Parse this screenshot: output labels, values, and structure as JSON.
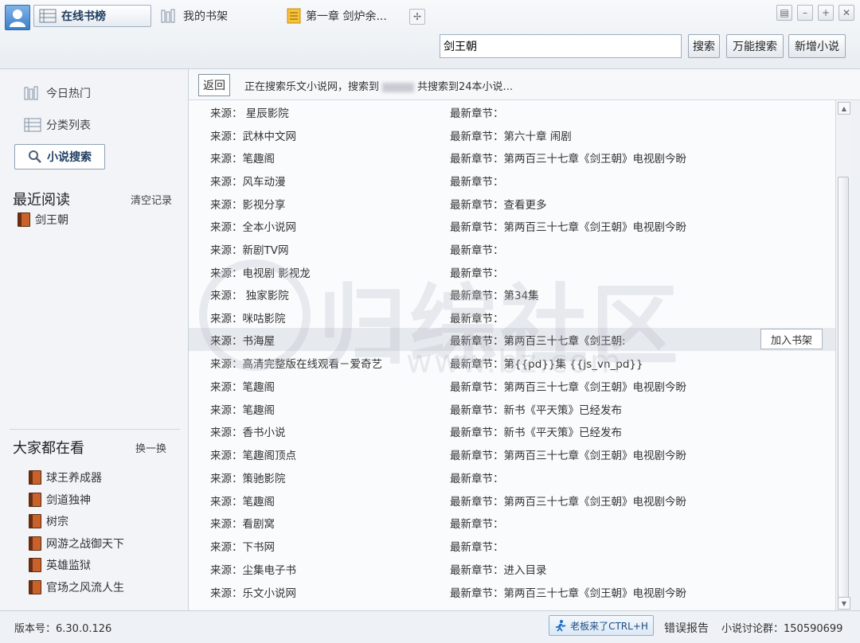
{
  "tabs": [
    {
      "label": "在线书榜"
    },
    {
      "label": "我的书架"
    },
    {
      "label": "第一章 剑炉余..."
    }
  ],
  "search": {
    "value": "剑王朝"
  },
  "buttons": {
    "search": "搜索",
    "universal_search": "万能搜索",
    "add_novel": "新增小说"
  },
  "sidebar": {
    "today_hot": "今日热门",
    "category_list": "分类列表",
    "novel_search": "小说搜索",
    "recent_title": "最近阅读",
    "clear_record": "清空记录",
    "recent_books": [
      "剑王朝"
    ],
    "popular_title": "大家都在看",
    "refresh": "换一换",
    "popular_books": [
      "球王养成器",
      "剑道独神",
      "树宗",
      "网游之战御天下",
      "英雄监狱",
      "官场之风流人生"
    ]
  },
  "main": {
    "back": "返回",
    "status_prefix": "正在搜索乐文小说网，搜索到",
    "status_suffix": "共搜索到24本小说...",
    "add_shelf": "加入书架",
    "rows": [
      {
        "src": "来源：  星辰影院",
        "chap": "最新章节："
      },
      {
        "src": "来源：武林中文网",
        "chap": "最新章节：第六十章 闹剧"
      },
      {
        "src": "来源：笔趣阁",
        "chap": "最新章节：第两百三十七章《剑王朝》电视剧今盼"
      },
      {
        "src": "来源：风车动漫",
        "chap": "最新章节："
      },
      {
        "src": "来源：影视分享",
        "chap": "最新章节：查看更多"
      },
      {
        "src": "来源：全本小说网",
        "chap": "最新章节：第两百三十七章《剑王朝》电视剧今盼"
      },
      {
        "src": "来源：新剧TV网",
        "chap": "最新章节："
      },
      {
        "src": "来源：电视剧 影视龙",
        "chap": "最新章节："
      },
      {
        "src": "来源：  独家影院",
        "chap": "最新章节：第34集"
      },
      {
        "src": "来源：咪咕影院",
        "chap": "最新章节："
      },
      {
        "src": "来源：书海屋",
        "chap": "最新章节：第两百三十七章《剑王朝:"
      },
      {
        "src": "来源：高清完整版在线观看－爱奇艺",
        "chap": "最新章节：第{{pd}}集 {{js_vn_pd}}"
      },
      {
        "src": "来源：笔趣阁",
        "chap": "最新章节：第两百三十七章《剑王朝》电视剧今盼"
      },
      {
        "src": "来源：笔趣阁",
        "chap": "最新章节：新书《平天策》已经发布"
      },
      {
        "src": "来源：香书小说",
        "chap": "最新章节：新书《平天策》已经发布"
      },
      {
        "src": "来源：笔趣阁顶点",
        "chap": "最新章节：第两百三十七章《剑王朝》电视剧今盼"
      },
      {
        "src": "来源：策驰影院",
        "chap": "最新章节："
      },
      {
        "src": "来源：笔趣阁",
        "chap": "最新章节：第两百三十七章《剑王朝》电视剧今盼"
      },
      {
        "src": "来源：看剧窝",
        "chap": "最新章节："
      },
      {
        "src": "来源：下书网",
        "chap": "最新章节："
      },
      {
        "src": "来源：尘集电子书",
        "chap": "最新章节：进入目录"
      },
      {
        "src": "来源：乐文小说网",
        "chap": "最新章节：第两百三十七章《剑王朝》电视剧今盼"
      }
    ]
  },
  "watermark": {
    "text": "归综社区",
    "url": "www.bz.com"
  },
  "footer": {
    "version": "版本号：6.30.0.126",
    "boss": "老板来了CTRL+H",
    "error_report": "错误报告",
    "group": "小说讨论群：150590699"
  }
}
